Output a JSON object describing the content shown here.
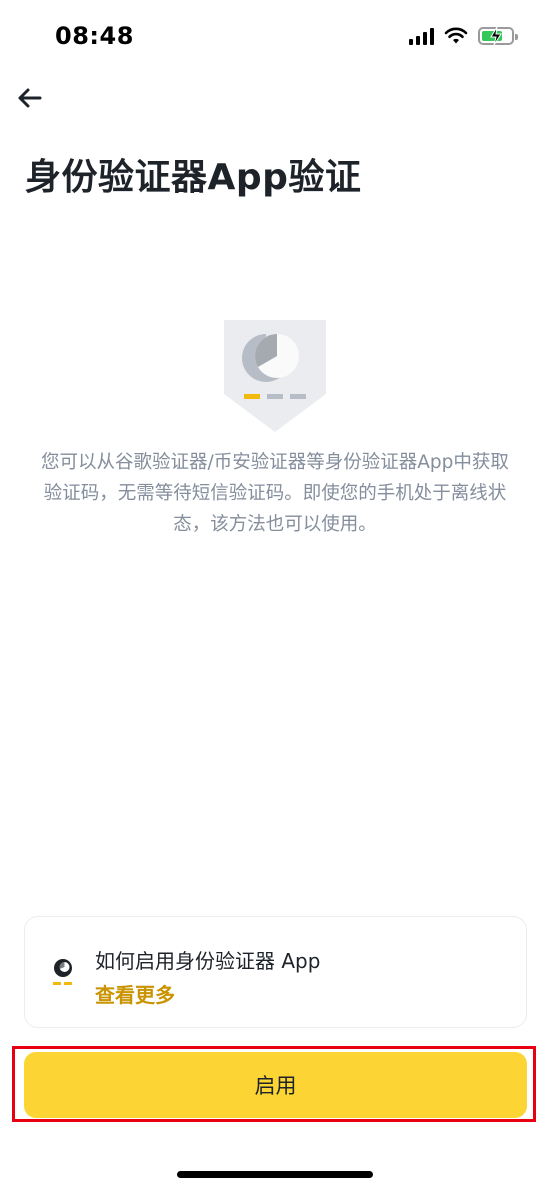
{
  "status_bar": {
    "time": "08:48",
    "icons": [
      "signal-icon",
      "wifi-icon",
      "battery-charging-icon"
    ]
  },
  "header": {
    "back_icon": "arrow-left-icon",
    "title": "身份验证器App验证"
  },
  "illustration": {
    "icon": "authenticator-shield-icon"
  },
  "description": {
    "lines": [
      "您可以从谷歌验证器/币安验证器等身份验证器App中获取",
      "验证码，无需等待短信验证码。即使您的手机处于离线状",
      "态，该方法也可以使用。"
    ]
  },
  "info_card": {
    "icon": "authenticator-icon",
    "title": "如何启用身份验证器 App",
    "link": "查看更多"
  },
  "enable_button": {
    "label": "启用"
  },
  "colors": {
    "accent": "#fcd535",
    "link": "#c99400",
    "muted_text": "#848e9c",
    "highlight_border": "#e60012"
  }
}
